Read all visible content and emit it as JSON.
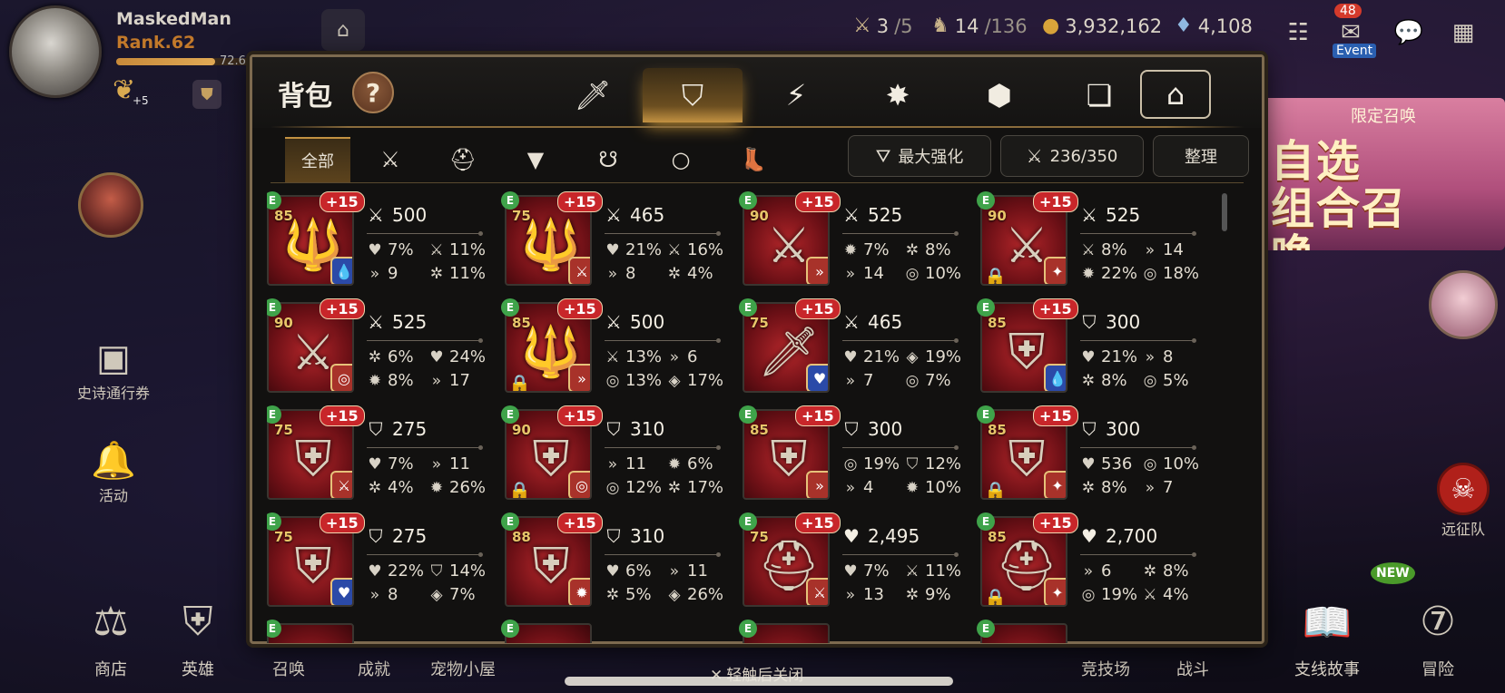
{
  "player": {
    "name": "MaskedMan",
    "rank": "Rank.62",
    "exp_text": "72.6",
    "exp_fraction": 0.726,
    "wing_badge": "+5"
  },
  "resources": [
    {
      "icon": "stamina-icon",
      "glyph": "⚔",
      "value": "3",
      "max": "/5"
    },
    {
      "icon": "knight-icon",
      "glyph": "♞",
      "value": "14",
      "max": "/136"
    },
    {
      "icon": "gold-coin-icon",
      "glyph": "●",
      "value": "3,932,162",
      "max": ""
    },
    {
      "icon": "crystal-icon",
      "glyph": "♦",
      "value": "4,108",
      "max": ""
    }
  ],
  "event": {
    "count": "48",
    "label": "Event"
  },
  "left_menu": [
    {
      "icon": "chest-icon",
      "glyph": "▣",
      "label": "史诗通行券"
    },
    {
      "icon": "bell-icon",
      "glyph": "🔔",
      "label": "活动"
    }
  ],
  "banner": {
    "top": "限定召唤",
    "main_line1": "自选",
    "main_line2": "组合召唤..."
  },
  "expedition_label": "远征队",
  "bottom_menu": [
    {
      "icon": "scales-icon",
      "glyph": "⚖",
      "label": "商店"
    },
    {
      "icon": "helmet-icon",
      "glyph": "⛨",
      "label": "英雄"
    },
    {
      "icon": "summon-icon",
      "glyph": "",
      "label": "召唤"
    },
    {
      "icon": "achievement-icon",
      "glyph": "",
      "label": "成就"
    },
    {
      "icon": "pet-house-icon",
      "glyph": "",
      "label": "宠物小屋"
    },
    {
      "icon": "arena-icon",
      "glyph": "",
      "label": "竞技场"
    },
    {
      "icon": "battle-icon",
      "glyph": "",
      "label": "战斗"
    },
    {
      "icon": "book-icon",
      "glyph": "📖",
      "label": "支线故事"
    },
    {
      "icon": "adventure-icon",
      "glyph": "⑦",
      "label": "冒险"
    }
  ],
  "new_badge": "NEW",
  "close_hint": "轻触后关闭",
  "inventory": {
    "title": "背包",
    "help": "?",
    "category_tabs": [
      {
        "name": "tab-hero-gear",
        "glyph": "🗡",
        "active": false
      },
      {
        "name": "tab-equipment",
        "glyph": "⛉",
        "active": true
      },
      {
        "name": "tab-skill",
        "glyph": "⚡",
        "active": false
      },
      {
        "name": "tab-rune",
        "glyph": "✸",
        "active": false
      },
      {
        "name": "tab-material",
        "glyph": "⬢",
        "active": false
      },
      {
        "name": "tab-scroll",
        "glyph": "❏",
        "active": false
      },
      {
        "name": "tab-storage",
        "glyph": "⌂",
        "active": false
      }
    ],
    "sub_tabs": [
      {
        "name": "subtab-all",
        "label": "全部",
        "glyph": "",
        "active": true
      },
      {
        "name": "subtab-weapon",
        "label": "",
        "glyph": "⚔",
        "active": false
      },
      {
        "name": "subtab-helmet",
        "label": "",
        "glyph": "⛑",
        "active": false
      },
      {
        "name": "subtab-armor",
        "label": "",
        "glyph": "▼",
        "active": false
      },
      {
        "name": "subtab-necklace",
        "label": "",
        "glyph": "☋",
        "active": false
      },
      {
        "name": "subtab-ring",
        "label": "",
        "glyph": "○",
        "active": false
      },
      {
        "name": "subtab-boots",
        "label": "",
        "glyph": "👢",
        "active": false
      }
    ],
    "sort_label": "最大强化",
    "capacity": "236/350",
    "organize_label": "整理",
    "items": [
      {
        "tier": "85",
        "plus": "+15",
        "art": "🔱",
        "set": "💧",
        "set_color": "#2b4aa8",
        "locked": false,
        "main": {
          "icon": "⚔",
          "value": "500"
        },
        "subs": [
          [
            "♥",
            "7%"
          ],
          [
            "⚔",
            "11%"
          ],
          [
            "»",
            "9"
          ],
          [
            "✲",
            "11%"
          ]
        ]
      },
      {
        "tier": "75",
        "plus": "+15",
        "art": "🔱",
        "set": "⚔",
        "set_color": "#a8322a",
        "locked": false,
        "main": {
          "icon": "⚔",
          "value": "465"
        },
        "subs": [
          [
            "♥",
            "21%"
          ],
          [
            "⚔",
            "16%"
          ],
          [
            "»",
            "8"
          ],
          [
            "✲",
            "4%"
          ]
        ]
      },
      {
        "tier": "90",
        "plus": "+15",
        "art": "⚔",
        "set": "»",
        "set_color": "#a8322a",
        "locked": false,
        "main": {
          "icon": "⚔",
          "value": "525"
        },
        "subs": [
          [
            "✹",
            "7%"
          ],
          [
            "✲",
            "8%"
          ],
          [
            "»",
            "14"
          ],
          [
            "◎",
            "10%"
          ]
        ]
      },
      {
        "tier": "90",
        "plus": "+15",
        "art": "⚔",
        "set": "✦",
        "set_color": "#a8322a",
        "locked": true,
        "main": {
          "icon": "⚔",
          "value": "525"
        },
        "subs": [
          [
            "⚔",
            "8%"
          ],
          [
            "»",
            "14"
          ],
          [
            "✹",
            "22%"
          ],
          [
            "◎",
            "18%"
          ]
        ]
      },
      {
        "tier": "90",
        "plus": "+15",
        "art": "⚔",
        "set": "◎",
        "set_color": "#a8322a",
        "locked": false,
        "main": {
          "icon": "⚔",
          "value": "525"
        },
        "subs": [
          [
            "✲",
            "6%"
          ],
          [
            "♥",
            "24%"
          ],
          [
            "✹",
            "8%"
          ],
          [
            "»",
            "17"
          ]
        ]
      },
      {
        "tier": "85",
        "plus": "+15",
        "art": "🔱",
        "set": "»",
        "set_color": "#a8322a",
        "locked": true,
        "main": {
          "icon": "⚔",
          "value": "500"
        },
        "subs": [
          [
            "⚔",
            "13%"
          ],
          [
            "»",
            "6"
          ],
          [
            "◎",
            "13%"
          ],
          [
            "◈",
            "17%"
          ]
        ]
      },
      {
        "tier": "75",
        "plus": "+15",
        "art": "🗡",
        "set": "♥",
        "set_color": "#2b4aa8",
        "locked": false,
        "main": {
          "icon": "⚔",
          "value": "465"
        },
        "subs": [
          [
            "♥",
            "21%"
          ],
          [
            "◈",
            "19%"
          ],
          [
            "»",
            "7"
          ],
          [
            "◎",
            "7%"
          ]
        ]
      },
      {
        "tier": "85",
        "plus": "+15",
        "art": "⛨",
        "set": "💧",
        "set_color": "#2b4aa8",
        "locked": false,
        "main": {
          "icon": "⛉",
          "value": "300"
        },
        "subs": [
          [
            "♥",
            "21%"
          ],
          [
            "»",
            "8"
          ],
          [
            "✲",
            "8%"
          ],
          [
            "◎",
            "5%"
          ]
        ]
      },
      {
        "tier": "75",
        "plus": "+15",
        "art": "⛨",
        "set": "⚔",
        "set_color": "#a8322a",
        "locked": false,
        "main": {
          "icon": "⛉",
          "value": "275"
        },
        "subs": [
          [
            "♥",
            "7%"
          ],
          [
            "»",
            "11"
          ],
          [
            "✲",
            "4%"
          ],
          [
            "✹",
            "26%"
          ]
        ]
      },
      {
        "tier": "90",
        "plus": "+15",
        "art": "⛨",
        "set": "◎",
        "set_color": "#a8322a",
        "locked": true,
        "main": {
          "icon": "⛉",
          "value": "310"
        },
        "subs": [
          [
            "»",
            "11"
          ],
          [
            "✹",
            "6%"
          ],
          [
            "◎",
            "12%"
          ],
          [
            "✲",
            "17%"
          ]
        ]
      },
      {
        "tier": "85",
        "plus": "+15",
        "art": "⛨",
        "set": "»",
        "set_color": "#a8322a",
        "locked": false,
        "main": {
          "icon": "⛉",
          "value": "300"
        },
        "subs": [
          [
            "◎",
            "19%"
          ],
          [
            "⛉",
            "12%"
          ],
          [
            "»",
            "4"
          ],
          [
            "✹",
            "10%"
          ]
        ]
      },
      {
        "tier": "85",
        "plus": "+15",
        "art": "⛨",
        "set": "✦",
        "set_color": "#a8322a",
        "locked": true,
        "main": {
          "icon": "⛉",
          "value": "300"
        },
        "subs": [
          [
            "♥",
            "536"
          ],
          [
            "◎",
            "10%"
          ],
          [
            "✲",
            "8%"
          ],
          [
            "»",
            "7"
          ]
        ]
      },
      {
        "tier": "75",
        "plus": "+15",
        "art": "⛨",
        "set": "♥",
        "set_color": "#2b4aa8",
        "locked": false,
        "main": {
          "icon": "⛉",
          "value": "275"
        },
        "subs": [
          [
            "♥",
            "22%"
          ],
          [
            "⛉",
            "14%"
          ],
          [
            "»",
            "8"
          ],
          [
            "◈",
            "7%"
          ]
        ]
      },
      {
        "tier": "88",
        "plus": "+15",
        "art": "⛨",
        "set": "✹",
        "set_color": "#a8322a",
        "locked": false,
        "main": {
          "icon": "⛉",
          "value": "310"
        },
        "subs": [
          [
            "♥",
            "6%"
          ],
          [
            "»",
            "11"
          ],
          [
            "✲",
            "5%"
          ],
          [
            "◈",
            "26%"
          ]
        ]
      },
      {
        "tier": "75",
        "plus": "+15",
        "art": "⛑",
        "set": "⚔",
        "set_color": "#a8322a",
        "locked": false,
        "main": {
          "icon": "♥",
          "value": "2,495"
        },
        "subs": [
          [
            "♥",
            "7%"
          ],
          [
            "⚔",
            "11%"
          ],
          [
            "»",
            "13"
          ],
          [
            "✲",
            "9%"
          ]
        ]
      },
      {
        "tier": "85",
        "plus": "+15",
        "art": "⛑",
        "set": "✦",
        "set_color": "#a8322a",
        "locked": true,
        "main": {
          "icon": "♥",
          "value": "2,700"
        },
        "subs": [
          [
            "»",
            "6"
          ],
          [
            "✲",
            "8%"
          ],
          [
            "◎",
            "19%"
          ],
          [
            "⚔",
            "4%"
          ]
        ]
      }
    ]
  }
}
